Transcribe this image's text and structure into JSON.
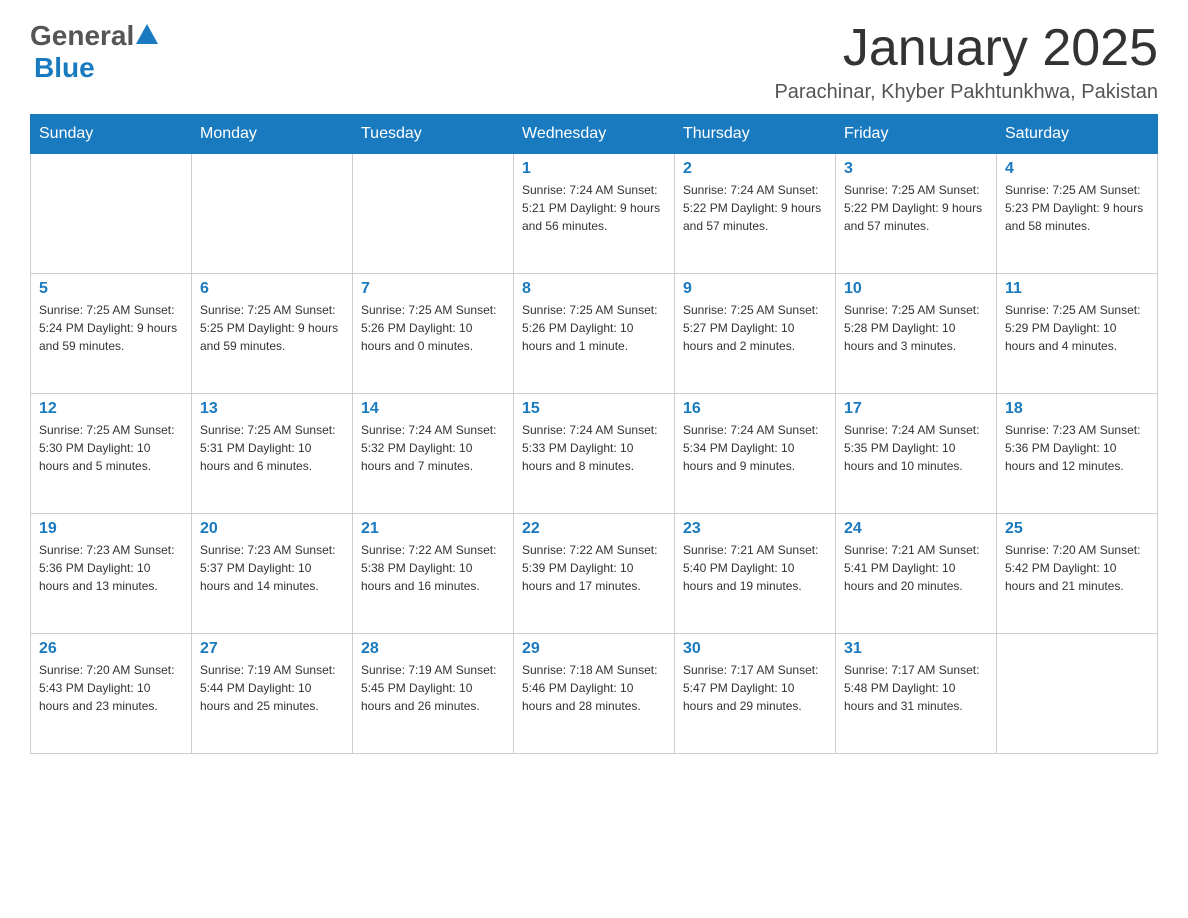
{
  "header": {
    "logo_general": "General",
    "logo_blue": "Blue",
    "month_title": "January 2025",
    "location": "Parachinar, Khyber Pakhtunkhwa, Pakistan"
  },
  "weekdays": [
    "Sunday",
    "Monday",
    "Tuesday",
    "Wednesday",
    "Thursday",
    "Friday",
    "Saturday"
  ],
  "weeks": [
    [
      {
        "day": "",
        "info": ""
      },
      {
        "day": "",
        "info": ""
      },
      {
        "day": "",
        "info": ""
      },
      {
        "day": "1",
        "info": "Sunrise: 7:24 AM\nSunset: 5:21 PM\nDaylight: 9 hours\nand 56 minutes."
      },
      {
        "day": "2",
        "info": "Sunrise: 7:24 AM\nSunset: 5:22 PM\nDaylight: 9 hours\nand 57 minutes."
      },
      {
        "day": "3",
        "info": "Sunrise: 7:25 AM\nSunset: 5:22 PM\nDaylight: 9 hours\nand 57 minutes."
      },
      {
        "day": "4",
        "info": "Sunrise: 7:25 AM\nSunset: 5:23 PM\nDaylight: 9 hours\nand 58 minutes."
      }
    ],
    [
      {
        "day": "5",
        "info": "Sunrise: 7:25 AM\nSunset: 5:24 PM\nDaylight: 9 hours\nand 59 minutes."
      },
      {
        "day": "6",
        "info": "Sunrise: 7:25 AM\nSunset: 5:25 PM\nDaylight: 9 hours\nand 59 minutes."
      },
      {
        "day": "7",
        "info": "Sunrise: 7:25 AM\nSunset: 5:26 PM\nDaylight: 10 hours\nand 0 minutes."
      },
      {
        "day": "8",
        "info": "Sunrise: 7:25 AM\nSunset: 5:26 PM\nDaylight: 10 hours\nand 1 minute."
      },
      {
        "day": "9",
        "info": "Sunrise: 7:25 AM\nSunset: 5:27 PM\nDaylight: 10 hours\nand 2 minutes."
      },
      {
        "day": "10",
        "info": "Sunrise: 7:25 AM\nSunset: 5:28 PM\nDaylight: 10 hours\nand 3 minutes."
      },
      {
        "day": "11",
        "info": "Sunrise: 7:25 AM\nSunset: 5:29 PM\nDaylight: 10 hours\nand 4 minutes."
      }
    ],
    [
      {
        "day": "12",
        "info": "Sunrise: 7:25 AM\nSunset: 5:30 PM\nDaylight: 10 hours\nand 5 minutes."
      },
      {
        "day": "13",
        "info": "Sunrise: 7:25 AM\nSunset: 5:31 PM\nDaylight: 10 hours\nand 6 minutes."
      },
      {
        "day": "14",
        "info": "Sunrise: 7:24 AM\nSunset: 5:32 PM\nDaylight: 10 hours\nand 7 minutes."
      },
      {
        "day": "15",
        "info": "Sunrise: 7:24 AM\nSunset: 5:33 PM\nDaylight: 10 hours\nand 8 minutes."
      },
      {
        "day": "16",
        "info": "Sunrise: 7:24 AM\nSunset: 5:34 PM\nDaylight: 10 hours\nand 9 minutes."
      },
      {
        "day": "17",
        "info": "Sunrise: 7:24 AM\nSunset: 5:35 PM\nDaylight: 10 hours\nand 10 minutes."
      },
      {
        "day": "18",
        "info": "Sunrise: 7:23 AM\nSunset: 5:36 PM\nDaylight: 10 hours\nand 12 minutes."
      }
    ],
    [
      {
        "day": "19",
        "info": "Sunrise: 7:23 AM\nSunset: 5:36 PM\nDaylight: 10 hours\nand 13 minutes."
      },
      {
        "day": "20",
        "info": "Sunrise: 7:23 AM\nSunset: 5:37 PM\nDaylight: 10 hours\nand 14 minutes."
      },
      {
        "day": "21",
        "info": "Sunrise: 7:22 AM\nSunset: 5:38 PM\nDaylight: 10 hours\nand 16 minutes."
      },
      {
        "day": "22",
        "info": "Sunrise: 7:22 AM\nSunset: 5:39 PM\nDaylight: 10 hours\nand 17 minutes."
      },
      {
        "day": "23",
        "info": "Sunrise: 7:21 AM\nSunset: 5:40 PM\nDaylight: 10 hours\nand 19 minutes."
      },
      {
        "day": "24",
        "info": "Sunrise: 7:21 AM\nSunset: 5:41 PM\nDaylight: 10 hours\nand 20 minutes."
      },
      {
        "day": "25",
        "info": "Sunrise: 7:20 AM\nSunset: 5:42 PM\nDaylight: 10 hours\nand 21 minutes."
      }
    ],
    [
      {
        "day": "26",
        "info": "Sunrise: 7:20 AM\nSunset: 5:43 PM\nDaylight: 10 hours\nand 23 minutes."
      },
      {
        "day": "27",
        "info": "Sunrise: 7:19 AM\nSunset: 5:44 PM\nDaylight: 10 hours\nand 25 minutes."
      },
      {
        "day": "28",
        "info": "Sunrise: 7:19 AM\nSunset: 5:45 PM\nDaylight: 10 hours\nand 26 minutes."
      },
      {
        "day": "29",
        "info": "Sunrise: 7:18 AM\nSunset: 5:46 PM\nDaylight: 10 hours\nand 28 minutes."
      },
      {
        "day": "30",
        "info": "Sunrise: 7:17 AM\nSunset: 5:47 PM\nDaylight: 10 hours\nand 29 minutes."
      },
      {
        "day": "31",
        "info": "Sunrise: 7:17 AM\nSunset: 5:48 PM\nDaylight: 10 hours\nand 31 minutes."
      },
      {
        "day": "",
        "info": ""
      }
    ]
  ],
  "colors": {
    "header_bg": "#1a7abf",
    "day_number": "#1a7abf",
    "logo_blue": "#1a7abf"
  }
}
